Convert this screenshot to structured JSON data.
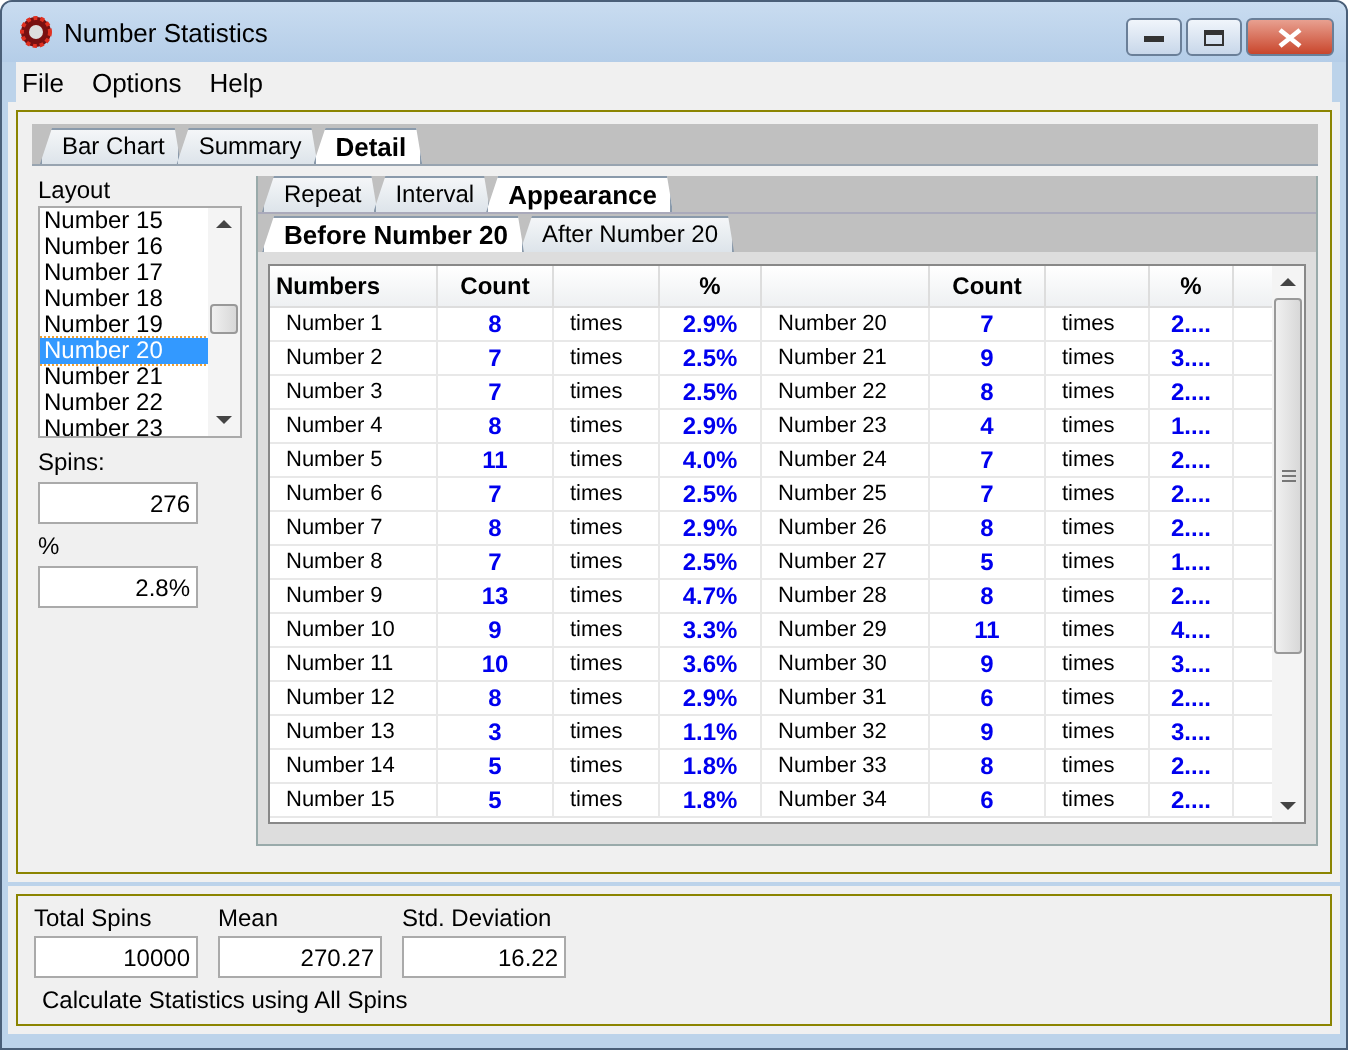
{
  "window": {
    "title": "Number Statistics"
  },
  "menu": [
    "File",
    "Options",
    "Help"
  ],
  "tabs": [
    {
      "label": "Bar Chart",
      "selected": false
    },
    {
      "label": "Summary",
      "selected": false
    },
    {
      "label": "Detail",
      "selected": true
    }
  ],
  "layout": {
    "label": "Layout",
    "items": [
      {
        "label": "Number 15",
        "selected": false
      },
      {
        "label": "Number 16",
        "selected": false
      },
      {
        "label": "Number 17",
        "selected": false
      },
      {
        "label": "Number 18",
        "selected": false
      },
      {
        "label": "Number 19",
        "selected": false
      },
      {
        "label": "Number 20",
        "selected": true
      },
      {
        "label": "Number 21",
        "selected": false
      },
      {
        "label": "Number 22",
        "selected": false
      },
      {
        "label": "Number 23",
        "selected": false
      }
    ]
  },
  "spins": {
    "label": "Spins:",
    "value": "276"
  },
  "percent": {
    "label": "%",
    "value": "2.8%"
  },
  "detail_tabs": [
    {
      "label": "Repeat",
      "selected": false
    },
    {
      "label": "Interval",
      "selected": false
    },
    {
      "label": "Appearance",
      "selected": true
    }
  ],
  "range_tabs": [
    {
      "label": "Before Number 20",
      "selected": true
    },
    {
      "label": "After Number 20",
      "selected": false
    }
  ],
  "table": {
    "columns": [
      {
        "label": "Numbers"
      },
      {
        "label": "Count"
      },
      {},
      {
        "label": "%"
      },
      {},
      {
        "label": "Count"
      },
      {},
      {
        "label": "%"
      }
    ],
    "rows": [
      [
        "Number 1",
        "8",
        "times",
        "2.9%",
        "Number 20",
        "7",
        "times",
        "2...."
      ],
      [
        "Number 2",
        "7",
        "times",
        "2.5%",
        "Number 21",
        "9",
        "times",
        "3...."
      ],
      [
        "Number 3",
        "7",
        "times",
        "2.5%",
        "Number 22",
        "8",
        "times",
        "2...."
      ],
      [
        "Number 4",
        "8",
        "times",
        "2.9%",
        "Number 23",
        "4",
        "times",
        "1...."
      ],
      [
        "Number 5",
        "11",
        "times",
        "4.0%",
        "Number 24",
        "7",
        "times",
        "2...."
      ],
      [
        "Number 6",
        "7",
        "times",
        "2.5%",
        "Number 25",
        "7",
        "times",
        "2...."
      ],
      [
        "Number 7",
        "8",
        "times",
        "2.9%",
        "Number 26",
        "8",
        "times",
        "2...."
      ],
      [
        "Number 8",
        "7",
        "times",
        "2.5%",
        "Number 27",
        "5",
        "times",
        "1...."
      ],
      [
        "Number 9",
        "13",
        "times",
        "4.7%",
        "Number 28",
        "8",
        "times",
        "2...."
      ],
      [
        "Number 10",
        "9",
        "times",
        "3.3%",
        "Number 29",
        "11",
        "times",
        "4...."
      ],
      [
        "Number 11",
        "10",
        "times",
        "3.6%",
        "Number 30",
        "9",
        "times",
        "3...."
      ],
      [
        "Number 12",
        "8",
        "times",
        "2.9%",
        "Number 31",
        "6",
        "times",
        "2...."
      ],
      [
        "Number 13",
        "3",
        "times",
        "1.1%",
        "Number 32",
        "9",
        "times",
        "3...."
      ],
      [
        "Number 14",
        "5",
        "times",
        "1.8%",
        "Number 33",
        "8",
        "times",
        "2...."
      ],
      [
        "Number 15",
        "5",
        "times",
        "1.8%",
        "Number 34",
        "6",
        "times",
        "2...."
      ]
    ]
  },
  "summary": {
    "fields": [
      {
        "label": "Total Spins",
        "value": "10000"
      },
      {
        "label": "Mean",
        "value": "270.27"
      },
      {
        "label": "Std. Deviation",
        "value": "16.22"
      }
    ],
    "note": "Calculate Statistics using All Spins"
  }
}
